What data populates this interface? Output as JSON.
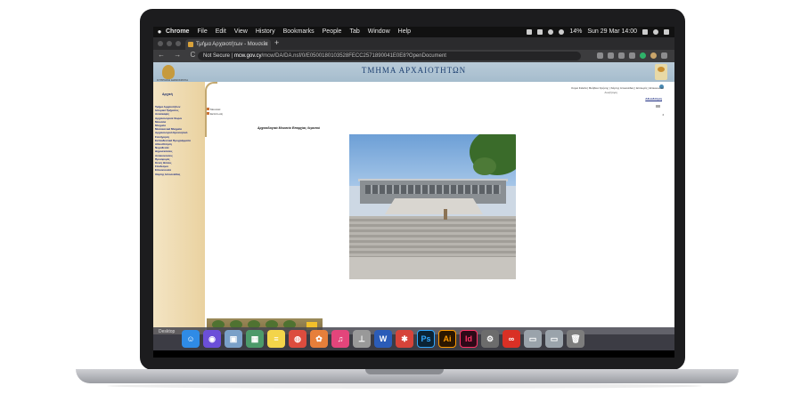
{
  "menubar": {
    "app": "Chrome",
    "items": [
      "File",
      "Edit",
      "View",
      "History",
      "Bookmarks",
      "People",
      "Tab",
      "Window",
      "Help"
    ],
    "battery": "14%",
    "clock": "Sun 29 Mar 14:00"
  },
  "browser": {
    "tab_title": "Τμήμα Αρχαιοτήτων - Μουσεία",
    "tab_close": "×",
    "new_tab": "+",
    "nav_glyphs": "← → C",
    "security": "Not Secure",
    "url_host": "mcw.gov.cy",
    "url_path": "/mcw/DA/DA.nsf/0/E0500180103528FECC2571890041E0E8?OpenDocument"
  },
  "site": {
    "banner_title": "ΤΜΗΜΑ ΑΡΧΑΙΟΤΗΤΩΝ",
    "emblem_label": "ΚΥΠΡΙΑΚΗ ΔΗΜΟΚΡΑΤΙΑ",
    "sidebar_heading": "Αρχική",
    "sidebar_items": [
      "Τμήμα Αρχαιοτήτων",
      "Ιστορικό Τμήματος",
      "Ανασκαφές",
      "Αρχαιολογικοί Χώροι",
      "Μουσεία",
      "Μνημεία",
      "Μεσαιωνικά Μνημεία",
      "Αρχαιολογικό Ερευνητικό",
      "Συντήρηση",
      "Εκπαιδευτικά Προγράμματα",
      "Αδειοδότηση",
      "Νομοθεσία",
      "Δημοσιεύσεις",
      "Ανακοινώσεις",
      "Προσφορές",
      "Κενές Θέσεις",
      "Σύνδεσμοι",
      "Επικοινωνία",
      "Χάρτης Ιστοσελίδας"
    ],
    "top_links": "Κύρια Σελίδα | Βοήθεια Χρήσης | Χάρτης Ιστοσελίδας | Επιλογές | Επικοινωνία",
    "top_sub": "Αναζήτηση",
    "advanced_search": "Αδειοδότηση",
    "small_right": "4",
    "back_link_1": "Μουσεία",
    "back_link_2": "Εκτύπωση",
    "page_heading": "Αρχαιολογικό Μουσείο Επαρχίας Λεμεσού"
  },
  "dock": {
    "label": "Desktop",
    "apps": [
      {
        "name": "finder",
        "glyph": "☺",
        "color": "#2f8be6"
      },
      {
        "name": "siri",
        "glyph": "◉",
        "color": "#6b4fd8"
      },
      {
        "name": "preview",
        "glyph": "▣",
        "color": "#7aa0c8"
      },
      {
        "name": "photo-viewer",
        "glyph": "▦",
        "color": "#4c9a6a"
      },
      {
        "name": "notes",
        "glyph": "≡",
        "color": "#f3d44a"
      },
      {
        "name": "chrome",
        "glyph": "◍",
        "color": "#dc4c3e"
      },
      {
        "name": "photos",
        "glyph": "✿",
        "color": "#e77f3a"
      },
      {
        "name": "itunes",
        "glyph": "♫",
        "color": "#e3457b"
      },
      {
        "name": "scanner",
        "glyph": "⊥",
        "color": "#999999"
      },
      {
        "name": "word",
        "glyph": "W",
        "color": "#2b5cb8"
      },
      {
        "name": "popcorn",
        "glyph": "✱",
        "color": "#d6443a"
      },
      {
        "name": "photoshop",
        "glyph": "Ps",
        "color": "#0b2334"
      },
      {
        "name": "illustrator",
        "glyph": "Ai",
        "color": "#2b1600"
      },
      {
        "name": "indesign",
        "glyph": "Id",
        "color": "#2d0a18"
      },
      {
        "name": "system-preferences",
        "glyph": "⚙",
        "color": "#6c6c6c"
      },
      {
        "name": "creative-cloud",
        "glyph": "∞",
        "color": "#d93025"
      },
      {
        "name": "screenshot",
        "glyph": "▭",
        "color": "#9aa3ab"
      },
      {
        "name": "display",
        "glyph": "▭",
        "color": "#9aa3ab"
      },
      {
        "name": "trash",
        "glyph": "🗑",
        "color": "#7d7d7d"
      }
    ]
  }
}
